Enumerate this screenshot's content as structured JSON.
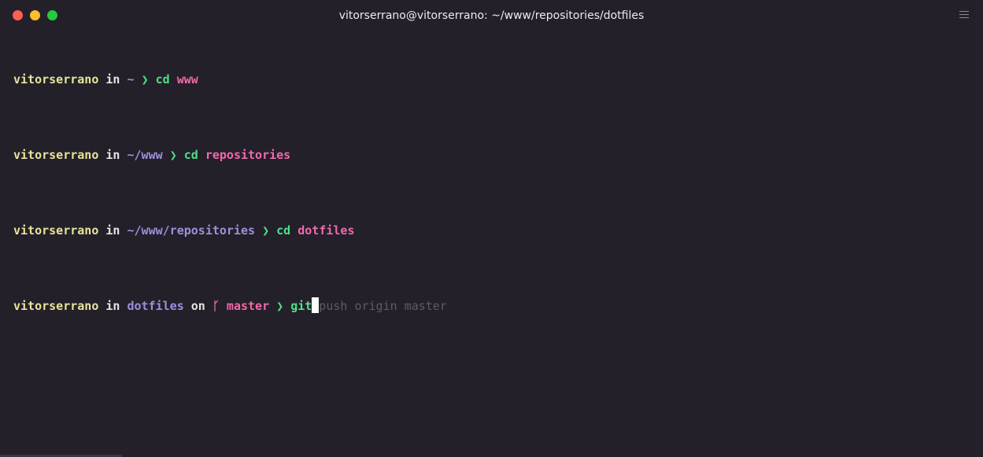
{
  "window": {
    "title": "vitorserrano@vitorserrano: ~/www/repositories/dotfiles",
    "controls": [
      "close",
      "minimize",
      "maximize"
    ],
    "menu_icon": "hamburger-menu-icon"
  },
  "prompt_symbol": "❯",
  "lines": [
    {
      "user": "vitorserrano",
      "in": "in",
      "path": "~",
      "command": "cd",
      "arg": "www"
    },
    {
      "user": "vitorserrano",
      "in": "in",
      "path": "~/www",
      "command": "cd",
      "arg": "repositories"
    },
    {
      "user": "vitorserrano",
      "in": "in",
      "path": "~/www/repositories",
      "command": "cd",
      "arg": "dotfiles"
    },
    {
      "user": "vitorserrano",
      "in": "in",
      "path": "dotfiles",
      "on": "on",
      "branch_icon": "ᚴ",
      "branch": "master",
      "command": "git",
      "suggestion": "push origin master"
    }
  ],
  "colors": {
    "background": "#232029",
    "user": "#e6e39c",
    "path": "#9f8fdc",
    "prompt": "#50e08a",
    "argument": "#f06aa8",
    "suggestion": "#5e5b66"
  }
}
